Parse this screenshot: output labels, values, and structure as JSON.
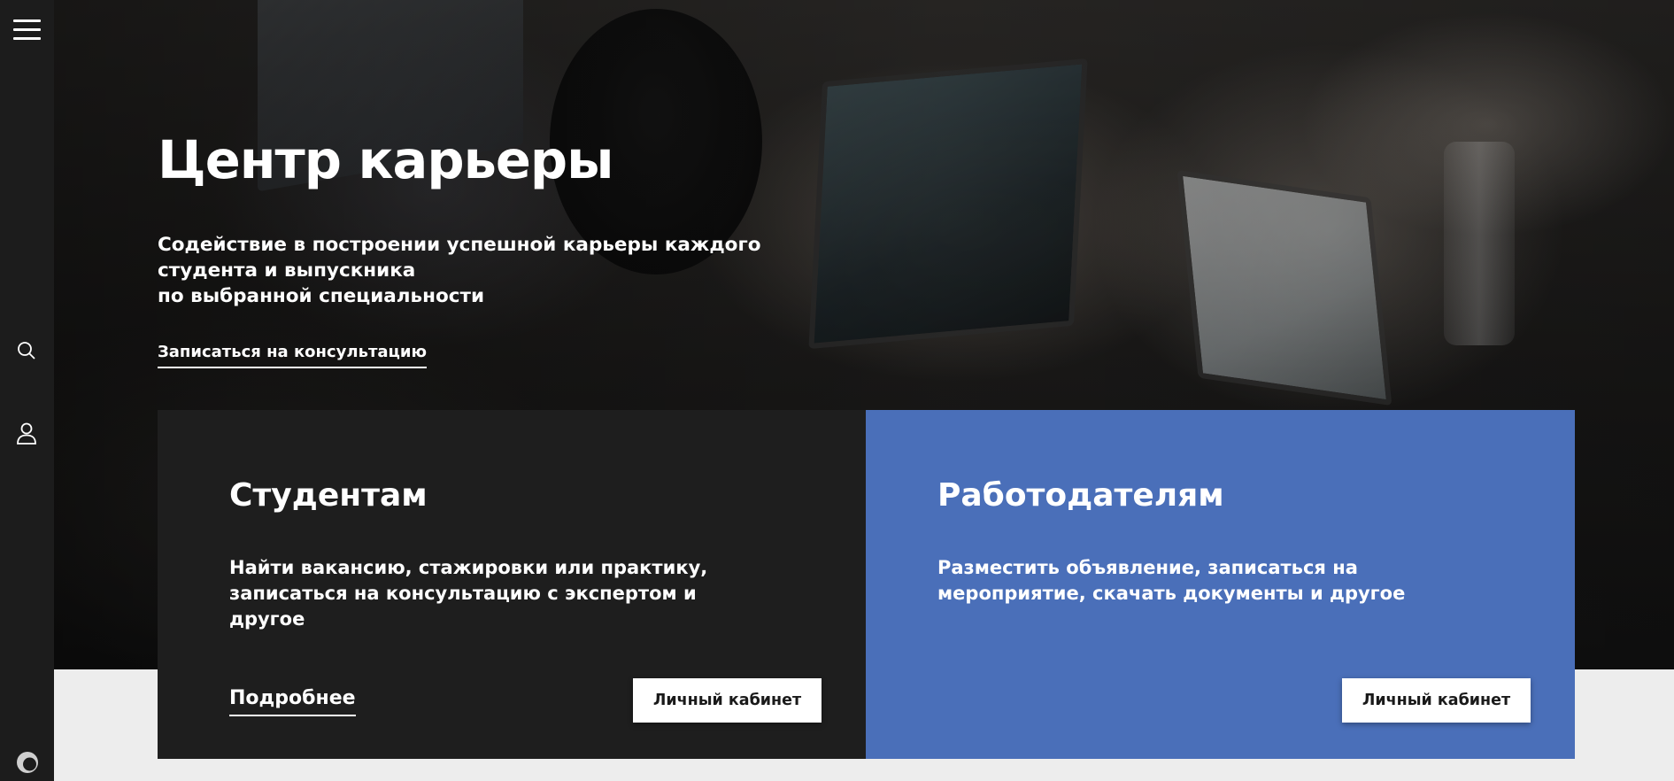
{
  "sidebar": {
    "menu_icon": "hamburger-menu-icon",
    "search_icon": "search-icon",
    "user_icon": "user-icon",
    "logo_icon": "spinner-logo-icon"
  },
  "hero": {
    "title": "Центр карьеры",
    "subtitle_lines": [
      "Содействие в построении успешной карьеры каждого",
      "студента и выпускника",
      "по выбранной специальности"
    ],
    "consult_link": "Записаться на консультацию"
  },
  "cards": {
    "students": {
      "title": "Студентам",
      "text_lines": [
        "Найти вакансию, стажировки или практику,",
        "записаться на консультацию с экспертом и",
        "другое"
      ],
      "more_link": "Подробнее",
      "cabinet_button": "Личный кабинет",
      "bg_color": "#1e1e1e"
    },
    "employers": {
      "title": "Работодателям",
      "text_lines": [
        "Разместить объявление, записаться на",
        "мероприятие, скачать документы и другое"
      ],
      "cabinet_button": "Личный кабинет",
      "bg_color": "#4a6fb9"
    }
  },
  "colors": {
    "sidebar_bg": "#1c1c1c",
    "page_bg": "#ededed",
    "accent_blue": "#4a6fb9"
  }
}
